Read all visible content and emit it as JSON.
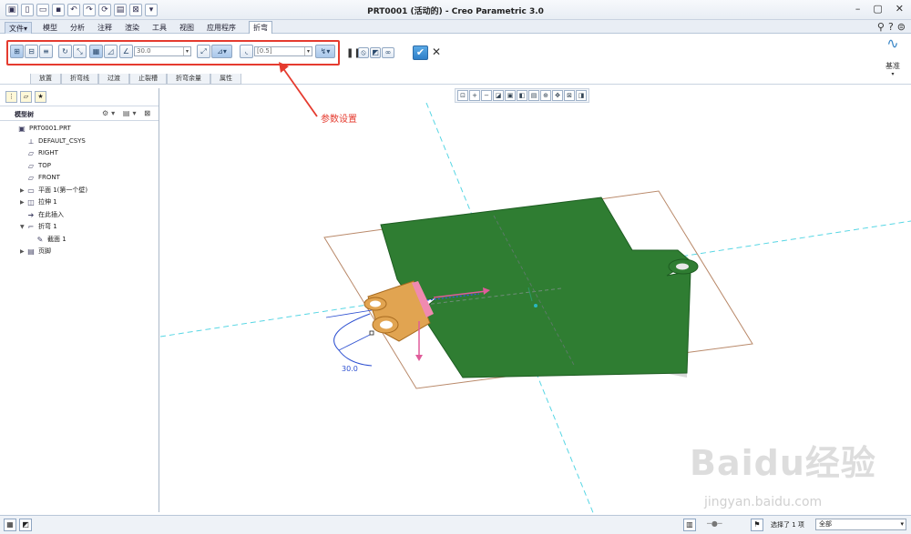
{
  "window": {
    "title": "PRT0001 (活动的) - Creo Parametric 3.0"
  },
  "menu": {
    "tabs": [
      "文件▾",
      "模型",
      "分析",
      "注释",
      "渲染",
      "工具",
      "视图",
      "应用程序",
      "折弯"
    ]
  },
  "ribbon": {
    "angle_value": "30.0",
    "radius_value": "[0.5]",
    "subtabs": [
      "放置",
      "折弯线",
      "过渡",
      "止裂槽",
      "折弯余量",
      "属性"
    ],
    "datum_label": "基准"
  },
  "annotation": {
    "text": "参数设置",
    "color": "#e53b2f"
  },
  "model_tree": {
    "header": "模型树",
    "nodes": [
      {
        "label": "PRT0001.PRT",
        "icon": "part-icon",
        "level": 0,
        "expander": ""
      },
      {
        "label": "DEFAULT_CSYS",
        "icon": "csys-icon",
        "level": 1,
        "expander": ""
      },
      {
        "label": "RIGHT",
        "icon": "plane-icon",
        "level": 1,
        "expander": ""
      },
      {
        "label": "TOP",
        "icon": "plane-icon",
        "level": 1,
        "expander": ""
      },
      {
        "label": "FRONT",
        "icon": "plane-icon",
        "level": 1,
        "expander": ""
      },
      {
        "label": "平面 1(第一个壁)",
        "icon": "wall-icon",
        "level": 1,
        "expander": "▶"
      },
      {
        "label": "拉伸 1",
        "icon": "extrude-icon",
        "level": 1,
        "expander": "▶"
      },
      {
        "label": "在此插入",
        "icon": "insert-icon",
        "level": 1,
        "expander": ""
      },
      {
        "label": "折弯 1",
        "icon": "bend-icon",
        "level": 1,
        "expander": "▼"
      },
      {
        "label": "截面 1",
        "icon": "sketch-icon",
        "level": 2,
        "expander": ""
      },
      {
        "label": "页脚",
        "icon": "footer-icon",
        "level": 1,
        "expander": "▶"
      }
    ]
  },
  "viewport": {
    "dimension_label": "30.0"
  },
  "status": {
    "selection": "选择了 1 项",
    "filter": "全部"
  },
  "watermark": {
    "brand": "Baidu经验",
    "url": "jingyan.baidu.com"
  }
}
